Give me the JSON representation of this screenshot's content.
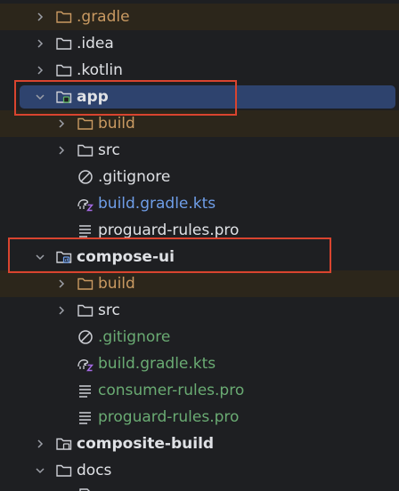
{
  "project_tree": {
    "items": [
      {
        "label": ".gradle",
        "kind": "folder",
        "state": "collapsed",
        "status": "excluded"
      },
      {
        "label": ".idea",
        "kind": "folder",
        "state": "collapsed",
        "status": "normal"
      },
      {
        "label": ".kotlin",
        "kind": "folder",
        "state": "collapsed",
        "status": "normal"
      },
      {
        "label": "app",
        "kind": "module",
        "state": "expanded",
        "status": "selected"
      },
      {
        "label": "build",
        "kind": "folder",
        "state": "collapsed",
        "status": "excluded"
      },
      {
        "label": "src",
        "kind": "folder",
        "state": "collapsed",
        "status": "normal"
      },
      {
        "label": ".gitignore",
        "kind": "ignore-file",
        "status": "normal"
      },
      {
        "label": "build.gradle.kts",
        "kind": "gradle-file",
        "status": "modified"
      },
      {
        "label": "proguard-rules.pro",
        "kind": "text-file",
        "status": "normal"
      },
      {
        "label": "compose-ui",
        "kind": "module",
        "state": "expanded",
        "status": "normal"
      },
      {
        "label": "build",
        "kind": "folder",
        "state": "collapsed",
        "status": "excluded"
      },
      {
        "label": "src",
        "kind": "folder",
        "state": "collapsed",
        "status": "normal"
      },
      {
        "label": ".gitignore",
        "kind": "ignore-file",
        "status": "added"
      },
      {
        "label": "build.gradle.kts",
        "kind": "gradle-file",
        "status": "added"
      },
      {
        "label": "consumer-rules.pro",
        "kind": "text-file",
        "status": "added"
      },
      {
        "label": "proguard-rules.pro",
        "kind": "text-file",
        "status": "added"
      },
      {
        "label": "composite-build",
        "kind": "module",
        "state": "collapsed",
        "status": "normal"
      },
      {
        "label": "docs",
        "kind": "folder",
        "state": "expanded",
        "status": "normal"
      }
    ]
  },
  "colors": {
    "background": "#1e1f22",
    "selection": "#2e436e",
    "excluded_row": "#2c261b",
    "excluded_text": "#c99a62",
    "modified_text": "#6f9ee8",
    "added_text": "#6aab73",
    "default_text": "#dfe1e5",
    "highlight_box": "#d9442f"
  }
}
